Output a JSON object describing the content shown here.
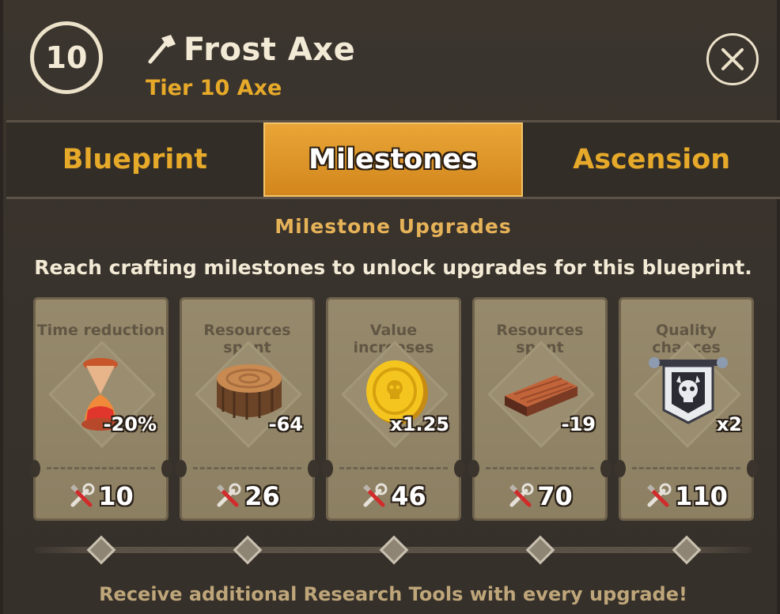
{
  "header": {
    "level": "10",
    "title": "Frost Axe",
    "subtitle": "Tier 10 Axe",
    "axe_icon": "axe-icon",
    "close_icon": "close-icon"
  },
  "tabs": [
    {
      "label": "Blueprint",
      "active": false
    },
    {
      "label": "Milestones",
      "active": true
    },
    {
      "label": "Ascension",
      "active": false
    }
  ],
  "section": {
    "title": "Milestone Upgrades",
    "description": "Reach crafting milestones to unlock upgrades for this blueprint."
  },
  "milestones": [
    {
      "label": "Time reduction",
      "icon": "hourglass-icon",
      "value": "-20%",
      "requirement": "10"
    },
    {
      "label": "Resources spent",
      "icon": "log-icon",
      "value": "-64",
      "requirement": "26"
    },
    {
      "label": "Value increases",
      "icon": "gold-coin-icon",
      "value": "x1.25",
      "requirement": "46"
    },
    {
      "label": "Resources spent",
      "icon": "plank-icon",
      "value": "-19",
      "requirement": "70"
    },
    {
      "label": "Quality chances",
      "icon": "skull-banner-icon",
      "value": "x2",
      "requirement": "110"
    }
  ],
  "requirement_icon": "research-tools-icon",
  "footer": "Receive additional Research Tools with every upgrade!",
  "colors": {
    "accent": "#e6a92a",
    "active_tab": "#df9a2c",
    "card": "#918466",
    "background": "#3a342d"
  }
}
